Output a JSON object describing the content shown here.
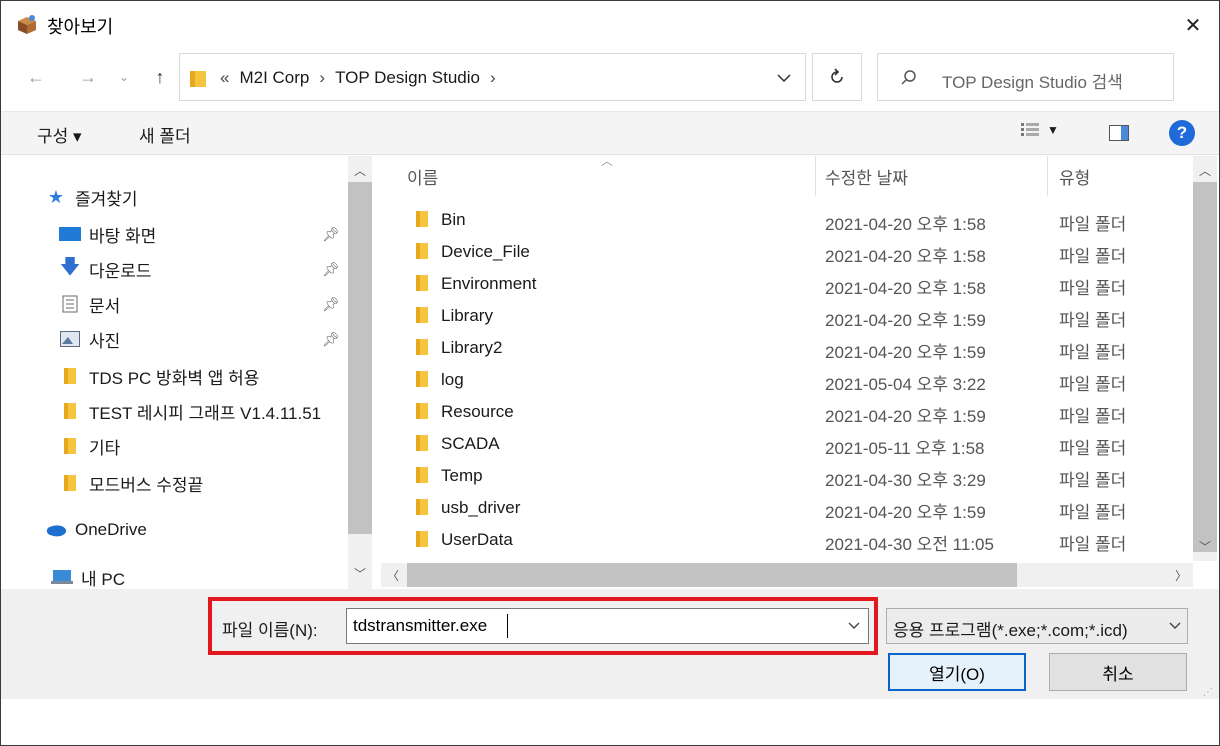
{
  "window": {
    "title": "찾아보기",
    "close_glyph": "✕"
  },
  "address": {
    "crumbs": [
      "«",
      "M2I Corp",
      "›",
      "TOP Design Studio",
      "›"
    ],
    "search_placeholder": "TOP Design Studio 검색"
  },
  "toolbar": {
    "organize": "구성 ▾",
    "new_folder": "새 폴더",
    "help": "?"
  },
  "nav": {
    "items": [
      {
        "label": "즐겨찾기",
        "icon": "star-icon"
      },
      {
        "label": "바탕 화면",
        "icon": "desktop-icon",
        "pinned": true
      },
      {
        "label": "다운로드",
        "icon": "download-icon",
        "pinned": true
      },
      {
        "label": "문서",
        "icon": "document-icon",
        "pinned": true
      },
      {
        "label": "사진",
        "icon": "picture-icon",
        "pinned": true
      },
      {
        "label": "TDS PC 방화벽 앱 허용",
        "icon": "folder-icon"
      },
      {
        "label": "TEST 레시피 그래프 V1.4.11.51",
        "icon": "folder-icon"
      },
      {
        "label": "기타",
        "icon": "folder-icon"
      },
      {
        "label": "모드버스 수정끝",
        "icon": "folder-icon"
      },
      {
        "label": "OneDrive",
        "icon": "cloud-icon"
      },
      {
        "label": "내 PC",
        "icon": "pc-icon"
      }
    ]
  },
  "files": {
    "columns": [
      "이름",
      "수정한 날짜",
      "유형"
    ],
    "rows": [
      {
        "name": "Bin",
        "date": "2021-04-20 오후 1:58",
        "type": "파일 폴더"
      },
      {
        "name": "Device_File",
        "date": "2021-04-20 오후 1:58",
        "type": "파일 폴더"
      },
      {
        "name": "Environment",
        "date": "2021-04-20 오후 1:58",
        "type": "파일 폴더"
      },
      {
        "name": "Library",
        "date": "2021-04-20 오후 1:59",
        "type": "파일 폴더"
      },
      {
        "name": "Library2",
        "date": "2021-04-20 오후 1:59",
        "type": "파일 폴더"
      },
      {
        "name": "log",
        "date": "2021-05-04 오후 3:22",
        "type": "파일 폴더"
      },
      {
        "name": "Resource",
        "date": "2021-04-20 오후 1:59",
        "type": "파일 폴더"
      },
      {
        "name": "SCADA",
        "date": "2021-05-11 오후 1:58",
        "type": "파일 폴더"
      },
      {
        "name": "Temp",
        "date": "2021-04-30 오후 3:29",
        "type": "파일 폴더"
      },
      {
        "name": "usb_driver",
        "date": "2021-04-20 오후 1:59",
        "type": "파일 폴더"
      },
      {
        "name": "UserData",
        "date": "2021-04-30 오전 11:05",
        "type": "파일 폴더"
      }
    ]
  },
  "bottom": {
    "filename_label": "파일 이름(N):",
    "filename_value": "tdstransmitter.exe",
    "filetype_value": "응용 프로그램(*.exe;*.com;*.icd)",
    "open_label": "열기(O)",
    "cancel_label": "취소"
  },
  "colors": {
    "accent": "#0a64c8",
    "highlight_border": "#e3181f",
    "folder": "#f5c542"
  }
}
